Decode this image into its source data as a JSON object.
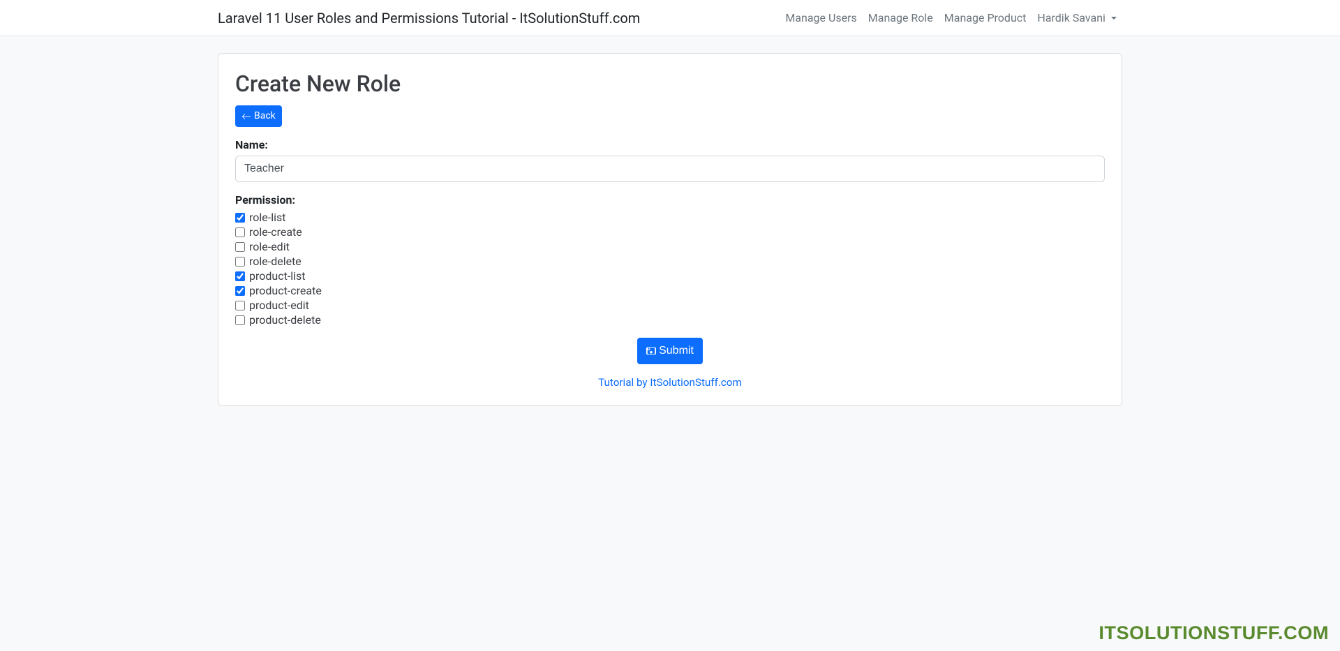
{
  "navbar": {
    "brand": "Laravel 11 User Roles and Permissions Tutorial - ItSolutionStuff.com",
    "items": [
      {
        "label": "Manage Users"
      },
      {
        "label": "Manage Role"
      },
      {
        "label": "Manage Product"
      },
      {
        "label": "Hardik Savani",
        "dropdown": true
      }
    ]
  },
  "page": {
    "title": "Create New Role",
    "back_label": "Back"
  },
  "form": {
    "name_label": "Name:",
    "name_value": "Teacher",
    "permission_label": "Permission:",
    "permissions": [
      {
        "name": "role-list",
        "checked": true
      },
      {
        "name": "role-create",
        "checked": false
      },
      {
        "name": "role-edit",
        "checked": false
      },
      {
        "name": "role-delete",
        "checked": false
      },
      {
        "name": "product-list",
        "checked": true
      },
      {
        "name": "product-create",
        "checked": true
      },
      {
        "name": "product-edit",
        "checked": false
      },
      {
        "name": "product-delete",
        "checked": false
      }
    ],
    "submit_label": "Submit"
  },
  "footer": {
    "tutorial_link": "Tutorial by ItSolutionStuff.com"
  },
  "watermark": "ITSOLUTIONSTUFF.COM"
}
